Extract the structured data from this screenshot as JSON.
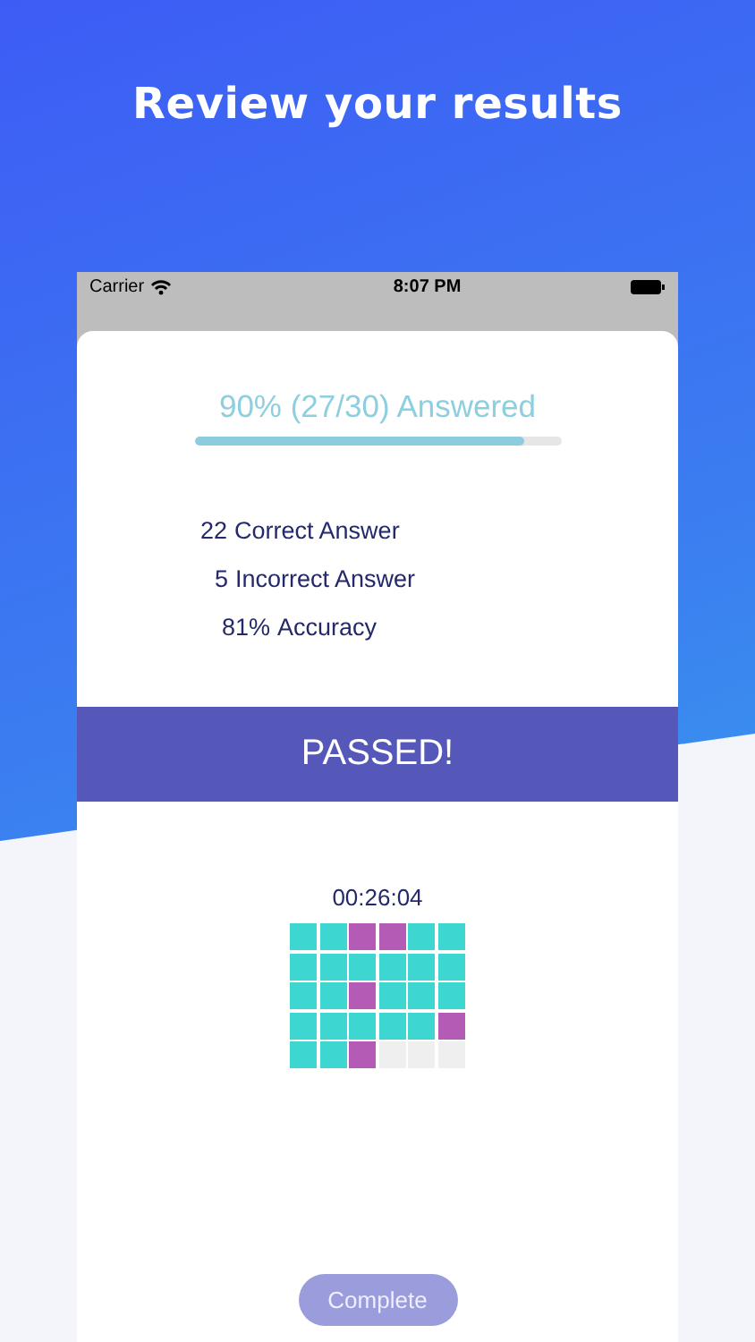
{
  "headline": "Review your results",
  "status_bar": {
    "carrier": "Carrier",
    "time": "8:07 PM"
  },
  "progress": {
    "label": "90% (27/30) Answered",
    "level": 0.9
  },
  "stats": [
    {
      "value": "22",
      "label": "Correct Answer"
    },
    {
      "value": "5",
      "label": "Incorrect Answer"
    },
    {
      "value": "81%",
      "label": "Accuracy"
    }
  ],
  "result_banner": "PASSED!",
  "timer": "00:26:04",
  "answer_grid": [
    {
      "kind": "correct"
    },
    {
      "kind": "correct"
    },
    {
      "kind": "incorrect"
    },
    {
      "kind": "incorrect"
    },
    {
      "kind": "correct"
    },
    {
      "kind": "correct"
    },
    {
      "kind": "correct"
    },
    {
      "kind": "correct"
    },
    {
      "kind": "correct"
    },
    {
      "kind": "correct"
    },
    {
      "kind": "correct"
    },
    {
      "kind": "correct"
    },
    {
      "kind": "correct"
    },
    {
      "kind": "correct"
    },
    {
      "kind": "incorrect"
    },
    {
      "kind": "correct"
    },
    {
      "kind": "correct"
    },
    {
      "kind": "correct"
    },
    {
      "kind": "correct"
    },
    {
      "kind": "correct"
    },
    {
      "kind": "correct"
    },
    {
      "kind": "correct"
    },
    {
      "kind": "correct"
    },
    {
      "kind": "incorrect"
    },
    {
      "kind": "correct"
    },
    {
      "kind": "correct"
    },
    {
      "kind": "incorrect"
    },
    {
      "kind": "unanswered"
    },
    {
      "kind": "unanswered"
    },
    {
      "kind": "unanswered"
    }
  ],
  "complete_button": {
    "label": "Complete",
    "disabled": true
  }
}
